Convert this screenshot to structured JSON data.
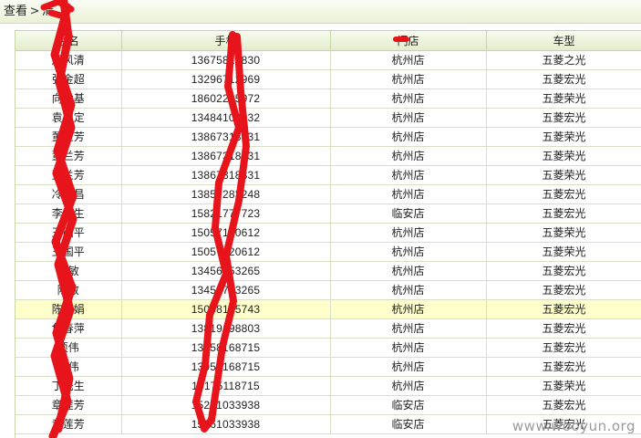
{
  "breadcrumb": {
    "items": [
      "查看",
      "清"
    ],
    "separator": ">"
  },
  "grid": {
    "headers": [
      "手机",
      "姓名",
      "门店",
      "车型"
    ],
    "rows": [
      {
        "name": "周风清",
        "phone": "13675812830",
        "store": "杭州店",
        "model": "五菱之光"
      },
      {
        "name": "张金超",
        "phone": "13296712969",
        "store": "杭州店",
        "model": "五菱宏光"
      },
      {
        "name": "向世基",
        "phone": "18602215972",
        "store": "杭州店",
        "model": "五菱荣光"
      },
      {
        "name": "袁国定",
        "phone": "13484100032",
        "store": "杭州店",
        "model": "五菱宏光"
      },
      {
        "name": "董兰芳",
        "phone": "13867318331",
        "store": "杭州店",
        "model": "五菱荣光"
      },
      {
        "name": "董兰芳",
        "phone": "13867318331",
        "store": "杭州店",
        "model": "五菱荣光"
      },
      {
        "name": "董兰芳",
        "phone": "13867318331",
        "store": "杭州店",
        "model": "五菱荣光"
      },
      {
        "name": "冷国昌",
        "phone": "13857283248",
        "store": "杭州店",
        "model": "五菱宏光"
      },
      {
        "name": "李元生",
        "phone": "15821777723",
        "store": "临安店",
        "model": "五菱宏光"
      },
      {
        "name": "王国平",
        "phone": "15057120612",
        "store": "杭州店",
        "model": "五菱荣光"
      },
      {
        "name": "王国平",
        "phone": "15057120612",
        "store": "杭州店",
        "model": "五菱荣光"
      },
      {
        "name": "陈敏",
        "phone": "13456753265",
        "store": "杭州店",
        "model": "五菱宏光"
      },
      {
        "name": "陈敏",
        "phone": "13456753265",
        "store": "杭州店",
        "model": "五菱宏光"
      },
      {
        "name": "陈丽娟",
        "phone": "15068135743",
        "store": "杭州店",
        "model": "五菱宏光"
      },
      {
        "name": "危春萍",
        "phone": "13819198803",
        "store": "杭州店",
        "model": "五菱宏光"
      },
      {
        "name": "项伟",
        "phone": "13958168715",
        "store": "杭州店",
        "model": "五菱宏光"
      },
      {
        "name": "项伟",
        "phone": "13958168715",
        "store": "杭州店",
        "model": "五菱宏光"
      },
      {
        "name": "丁先生",
        "phone": "13175118715",
        "store": "杭州店",
        "model": "五菱荣光"
      },
      {
        "name": "章莲芳",
        "phone": "15261033938",
        "store": "临安店",
        "model": "五菱宏光"
      },
      {
        "name": "章莲芳",
        "phone": "15261033938",
        "store": "临安店",
        "model": "五菱宏光"
      }
    ],
    "highlighted_row": 13
  },
  "watermark": "www.wooyun.org",
  "colors": {
    "highlight": "#ffffcc",
    "scribble": "#e8141b",
    "header": "#e3edcc"
  }
}
